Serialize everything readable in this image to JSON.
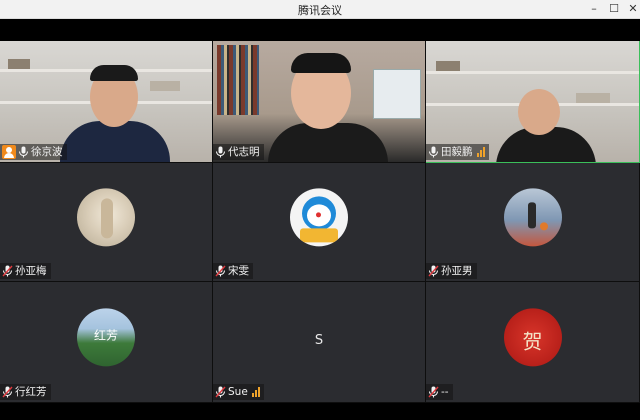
{
  "window": {
    "title": "腾讯会议",
    "controls": {
      "minimize": "–",
      "maximize": "☐",
      "close": "✕"
    }
  },
  "participants": [
    {
      "name": "徐京波",
      "mic": "on",
      "host": true,
      "video": true
    },
    {
      "name": "代志明",
      "mic": "on",
      "host": false,
      "video": true
    },
    {
      "name": "田毅鹏",
      "mic": "on",
      "host": false,
      "video": true,
      "signal": true
    },
    {
      "name": "孙亚梅",
      "mic": "off",
      "video": false,
      "avatar": "photo-avatar"
    },
    {
      "name": "宋雯",
      "mic": "off",
      "video": false,
      "avatar": "doraemon-avatar"
    },
    {
      "name": "孙亚男",
      "mic": "off",
      "video": false,
      "avatar": "basketball-avatar"
    },
    {
      "name": "行红芳",
      "mic": "off",
      "video": false,
      "avatar": "landscape-avatar",
      "avatar_text": "红芳"
    },
    {
      "name": "Sue",
      "mic": "off",
      "video": false,
      "avatar": "letter",
      "avatar_letter": "S",
      "signal": true
    },
    {
      "name": "--",
      "mic": "off",
      "video": false,
      "avatar": "calligraphy-avatar",
      "avatar_text": "贺"
    }
  ],
  "colors": {
    "accent_host": "#f08a1c",
    "active_border": "#3bbf5a",
    "tile_bg": "#2b2c30",
    "signal": "#f0a32a"
  }
}
